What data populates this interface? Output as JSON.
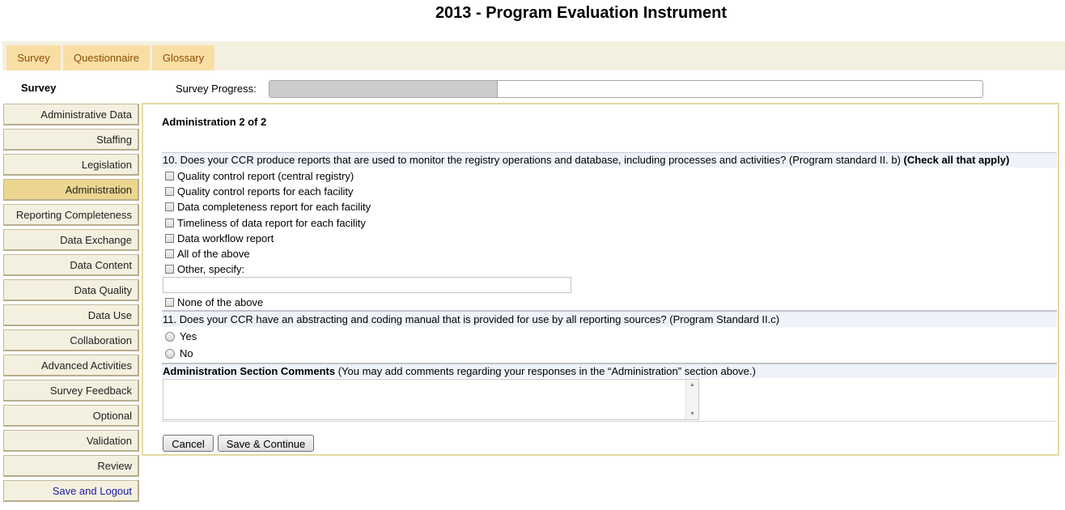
{
  "page": {
    "title": "2013 - Program Evaluation Instrument"
  },
  "tabs": [
    {
      "label": "Survey"
    },
    {
      "label": "Questionnaire"
    },
    {
      "label": "Glossary"
    }
  ],
  "sidebar": {
    "title": "Survey",
    "items": [
      {
        "label": "Administrative Data"
      },
      {
        "label": "Staffing"
      },
      {
        "label": "Legislation"
      },
      {
        "label": "Administration",
        "active": true
      },
      {
        "label": "Reporting Completeness"
      },
      {
        "label": "Data Exchange"
      },
      {
        "label": "Data Content"
      },
      {
        "label": "Data Quality"
      },
      {
        "label": "Data Use"
      },
      {
        "label": "Collaboration"
      },
      {
        "label": "Advanced Activities"
      },
      {
        "label": "Survey Feedback"
      },
      {
        "label": "Optional"
      },
      {
        "label": "Validation"
      },
      {
        "label": "Review"
      },
      {
        "label": "Save and Logout"
      }
    ]
  },
  "progress": {
    "label": "Survey Progress:",
    "value": 0.32
  },
  "form": {
    "section_title": "Administration 2 of 2",
    "q10": {
      "text": "10. Does your CCR produce reports that are used to monitor the registry operations and database, including processes and activities? (Program standard II. b) ",
      "emphasis": "(Check all that apply)",
      "options": [
        "Quality control report (central registry)",
        "Quality control reports for each facility",
        "Data completeness report for each facility",
        "Timeliness of data report for each facility",
        "Data workflow report",
        "All of the above",
        "Other, specify:"
      ],
      "other_value": "",
      "none_option": "None of the above"
    },
    "q11": {
      "text": "11. Does your CCR have an abstracting and coding manual that is provided for use by all reporting sources? (Program Standard II.c)",
      "options": [
        "Yes",
        "No"
      ]
    },
    "comments": {
      "label": "Administration Section Comments",
      "hint": " (You may add comments regarding your responses in the “Administration” section above.)",
      "value": ""
    },
    "buttons": {
      "cancel": "Cancel",
      "save": "Save & Continue"
    }
  }
}
